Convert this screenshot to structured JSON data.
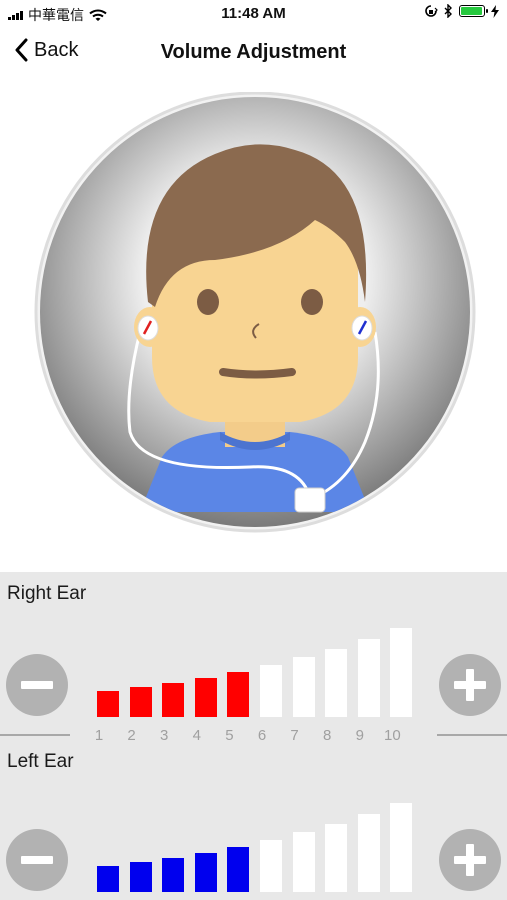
{
  "status_bar": {
    "carrier": "中華電信",
    "time": "11:48 AM"
  },
  "nav": {
    "back_label": "Back",
    "title": "Volume Adjustment"
  },
  "right_ear": {
    "label": "Right Ear",
    "level": 5,
    "active_color": "#ff0000"
  },
  "left_ear": {
    "label": "Left Ear",
    "level": 5,
    "active_color": "#0000ee"
  },
  "scale": [
    "1",
    "2",
    "3",
    "4",
    "5",
    "6",
    "7",
    "8",
    "9",
    "10"
  ],
  "inactive_color": "#ffffff",
  "icons": [
    "wifi-icon",
    "lock-rotation-icon",
    "bluetooth-icon",
    "battery-icon",
    "charging-icon",
    "chevron-left-icon",
    "minus-icon",
    "plus-icon"
  ]
}
